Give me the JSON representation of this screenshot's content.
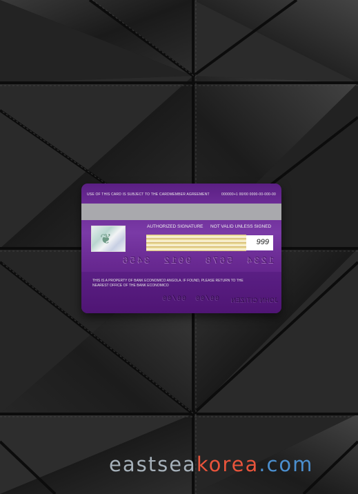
{
  "scene": {
    "surface": "black quilted leather",
    "stitch_color": "#2c2c2c"
  },
  "card": {
    "top_line_left": "USE OF THIS CARD IS SUBJECT TO THE CARDMEMBER AGREEMENT",
    "top_line_mid": "000000+1 00/00",
    "top_line_right": "0000-00-000-00",
    "authorized_signature": "AUTHORIZED SIGNATURE",
    "not_valid": "NOT VALID UNLESS SIGNED",
    "cvv": "999",
    "embossed_number": "1234 5678 9012 3456",
    "property_text": "THIS IS A PROPERTY OF BANK ECONOMICO ANGOLA. IF FOUND, PLEASE RETURN TO THE NEAREST OFFICE OF THE BANK ECONOMICO",
    "embossed_dates": "00/00 00/00",
    "embossed_name": "JOHN CITIZEN",
    "accent_color": "#6b2b95"
  },
  "watermark": {
    "part1": "eastsea",
    "part2": "korea",
    "part3": ".com"
  }
}
